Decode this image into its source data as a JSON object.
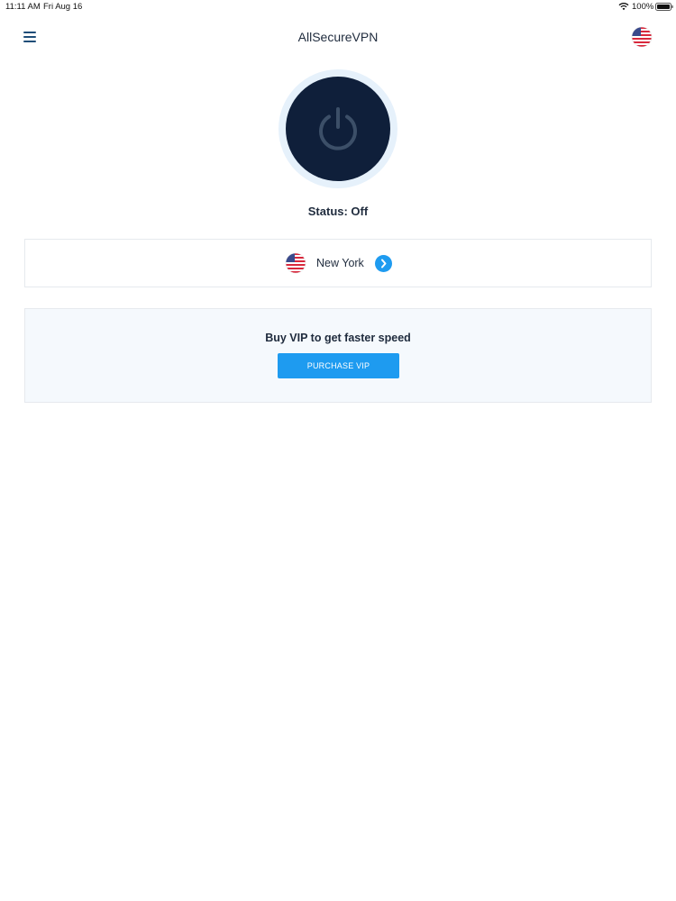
{
  "status_bar": {
    "time": "11:11 AM",
    "date": "Fri Aug 16",
    "battery": "100%"
  },
  "header": {
    "title": "AllSecureVPN",
    "menu_icon": "hamburger-menu-icon",
    "flag_icon": "us-flag-icon"
  },
  "connection": {
    "power_icon": "power-icon",
    "status": "Status: Off"
  },
  "location": {
    "name": "New York",
    "flag_icon": "us-flag-icon",
    "arrow_icon": "chevron-right-icon"
  },
  "vip": {
    "message": "Buy VIP to get faster speed",
    "button_label": "PURCHASE VIP"
  },
  "colors": {
    "primary": "#1e9bf0",
    "power_button": "#0f1f3a",
    "power_ring": "#e6f1fb",
    "card_bg": "#f5f9fd"
  }
}
